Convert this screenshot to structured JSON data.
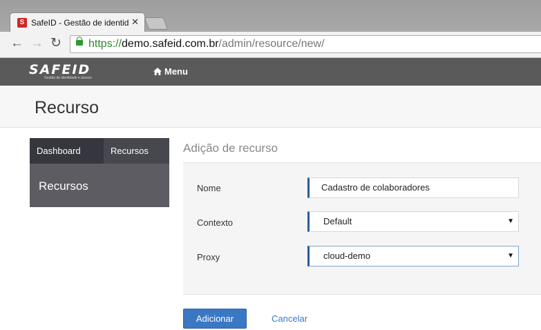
{
  "browser": {
    "tab_title": "SafeID - Gestão de identid",
    "url": {
      "scheme": "https://",
      "host": "demo.safeid.com.br",
      "path": "/admin/resource/new/"
    },
    "icons": [
      "back-arrow-icon",
      "forward-arrow-icon",
      "reload-icon",
      "lock-icon",
      "close-icon"
    ]
  },
  "app": {
    "logo_text": "SAFEID",
    "logo_tagline": "Gestão de identidade e acesso",
    "menu_label": "Menu",
    "colors": {
      "header_bg": "#5a5a5a",
      "accent": "#2c5b9a",
      "primary_button": "#3a78c4"
    }
  },
  "page": {
    "title": "Recurso"
  },
  "sidebar": {
    "tabs": [
      {
        "label": "Dashboard"
      },
      {
        "label": "Recursos"
      }
    ],
    "heading": "Recursos"
  },
  "form": {
    "section_title": "Adição de recurso",
    "fields": [
      {
        "label": "Nome",
        "value": "Cadastro de colaboradores"
      },
      {
        "label": "Contexto",
        "value": "Default"
      },
      {
        "label": "Proxy",
        "value": "cloud-demo"
      }
    ],
    "submit_label": "Adicionar",
    "cancel_label": "Cancelar"
  }
}
